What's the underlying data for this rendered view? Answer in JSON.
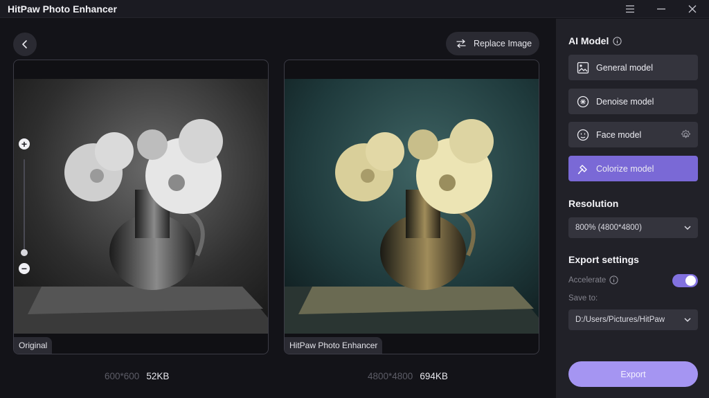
{
  "app": {
    "title": "HitPaw Photo Enhancer"
  },
  "toolbar": {
    "replace_label": "Replace Image"
  },
  "panels": {
    "original": {
      "tag": "Original",
      "dimensions": "600*600",
      "filesize": "52KB"
    },
    "enhanced": {
      "tag": "HitPaw Photo Enhancer",
      "dimensions": "4800*4800",
      "filesize": "694KB"
    }
  },
  "zoom": {
    "level": 0
  },
  "sidebar": {
    "ai_model_title": "AI Model",
    "models": [
      {
        "label": "General model",
        "icon": "image-icon",
        "active": false
      },
      {
        "label": "Denoise model",
        "icon": "denoise-icon",
        "active": false
      },
      {
        "label": "Face model",
        "icon": "face-icon",
        "active": false
      },
      {
        "label": "Colorize model",
        "icon": "colorize-icon",
        "active": true
      }
    ],
    "resolution_title": "Resolution",
    "resolution_value": "800% (4800*4800)",
    "export_settings_title": "Export settings",
    "accelerate_label": "Accelerate",
    "accelerate_on": true,
    "save_to_label": "Save to:",
    "save_path": "D:/Users/Pictures/HitPaw",
    "export_label": "Export"
  },
  "colors": {
    "accent": "#7a69d6",
    "export": "#a595f2",
    "panel": "#212128"
  }
}
